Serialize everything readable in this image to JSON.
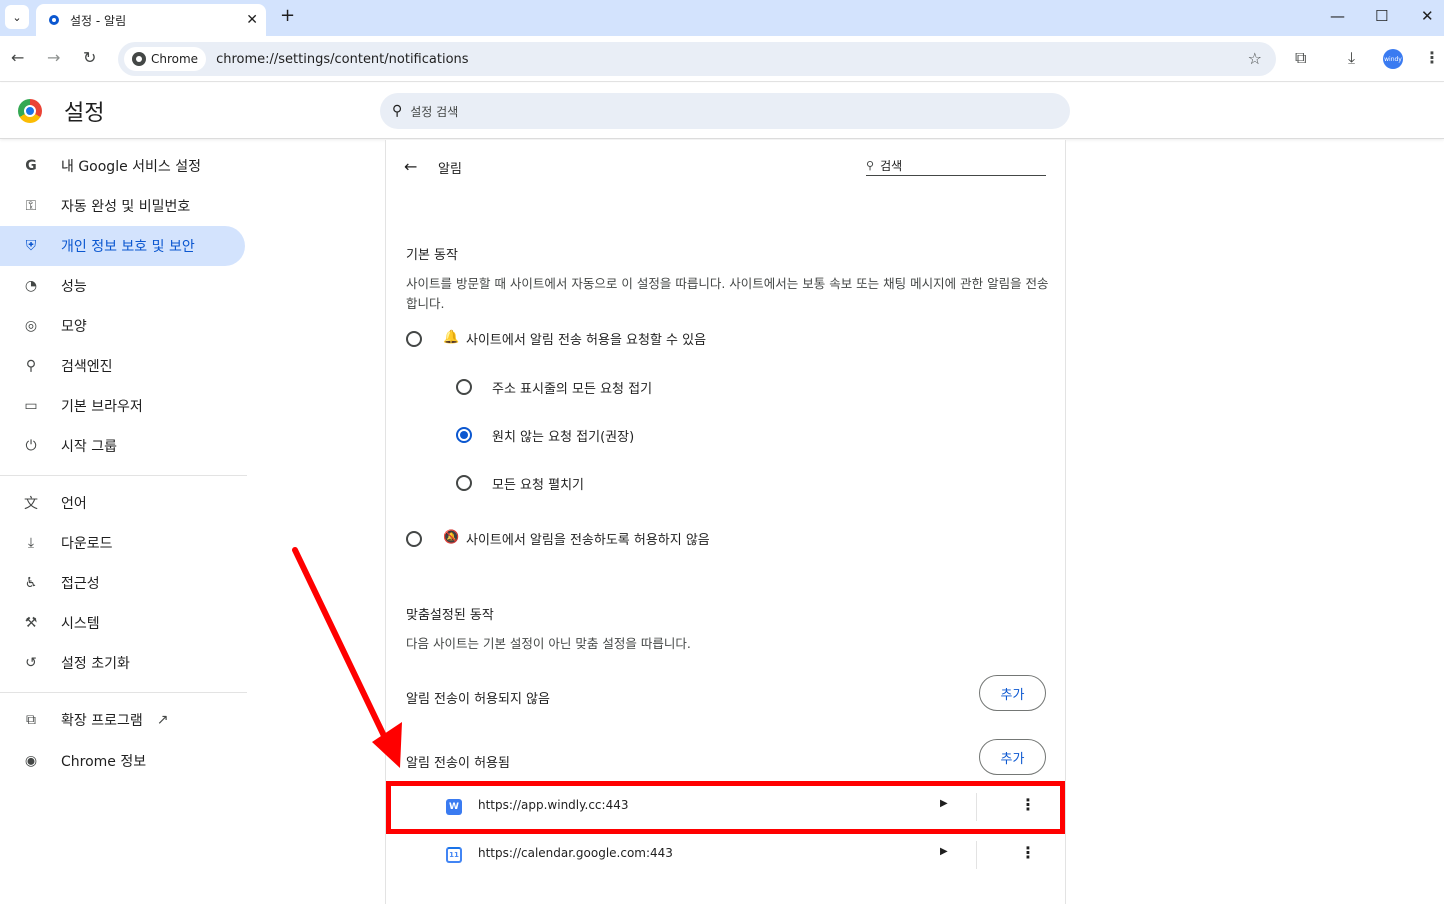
{
  "tab": {
    "title": "설정 - 알림",
    "close": "✕",
    "new_tab": "+"
  },
  "window": {
    "minimize": "—",
    "maximize": "☐",
    "close": "✕"
  },
  "toolbar": {
    "back": "←",
    "forward": "→",
    "reload": "↻",
    "chip_label": "Chrome",
    "url": "chrome://settings/content/notifications",
    "star": "☆",
    "windy_label": "windy"
  },
  "header": {
    "title": "설정",
    "search_placeholder": "설정 검색"
  },
  "sidebar": {
    "items": [
      {
        "label": "내 Google 서비스 설정",
        "icon": "G",
        "icon_name": "google-icon"
      },
      {
        "label": "자동 완성 및 비밀번호",
        "icon": "⚿",
        "icon_name": "key-icon"
      },
      {
        "label": "개인 정보 보호 및 보안",
        "icon": "⛨",
        "icon_name": "shield-icon",
        "active": true
      },
      {
        "label": "성능",
        "icon": "◔",
        "icon_name": "speedometer-icon"
      },
      {
        "label": "모양",
        "icon": "◎",
        "icon_name": "palette-icon"
      },
      {
        "label": "검색엔진",
        "icon": "⚲",
        "icon_name": "search-icon"
      },
      {
        "label": "기본 브라우저",
        "icon": "▭",
        "icon_name": "browser-icon"
      },
      {
        "label": "시작 그룹",
        "icon": "⏻",
        "icon_name": "power-icon"
      },
      {
        "label": "언어",
        "icon": "文",
        "icon_name": "translate-icon"
      },
      {
        "label": "다운로드",
        "icon": "⤓",
        "icon_name": "download-icon"
      },
      {
        "label": "접근성",
        "icon": "♿",
        "icon_name": "accessibility-icon"
      },
      {
        "label": "시스템",
        "icon": "⚒",
        "icon_name": "wrench-icon"
      },
      {
        "label": "설정 초기화",
        "icon": "↺",
        "icon_name": "reset-icon"
      },
      {
        "label": "확장 프로그램",
        "icon": "⧉",
        "icon_name": "puzzle-icon"
      },
      {
        "label": "Chrome 정보",
        "icon": "◉",
        "icon_name": "chrome-icon"
      }
    ]
  },
  "main": {
    "page_title": "알림",
    "search_label": "검색",
    "default_section": {
      "title": "기본 동작",
      "description": "사이트를 방문할 때 사이트에서 자동으로 이 설정을 따릅니다. 사이트에서는 보통 속보 또는 채팅 메시지에 관한 알림을 전송합니다.",
      "allow_option": "사이트에서 알림 전송 허용을 요청할 수 있음",
      "sub_options": [
        {
          "label": "주소 표시줄의 모든 요청 접기",
          "checked": false
        },
        {
          "label": "원치 않는 요청 접기(권장)",
          "checked": true
        },
        {
          "label": "모든 요청 펼치기",
          "checked": false
        }
      ],
      "block_option": "사이트에서 알림을 전송하도록 허용하지 않음"
    },
    "custom_section": {
      "title": "맞춤설정된 동작",
      "description": "다음 사이트는 기본 설정이 아닌 맞춤 설정을 따릅니다.",
      "blocked_title": "알림 전송이 허용되지 않음",
      "allowed_title": "알림 전송이 허용됨",
      "add_label": "추가",
      "sites": [
        {
          "url": "https://app.windly.cc:443",
          "favicon": "W"
        },
        {
          "url": "https://calendar.google.com:443",
          "favicon": "11"
        }
      ]
    }
  }
}
